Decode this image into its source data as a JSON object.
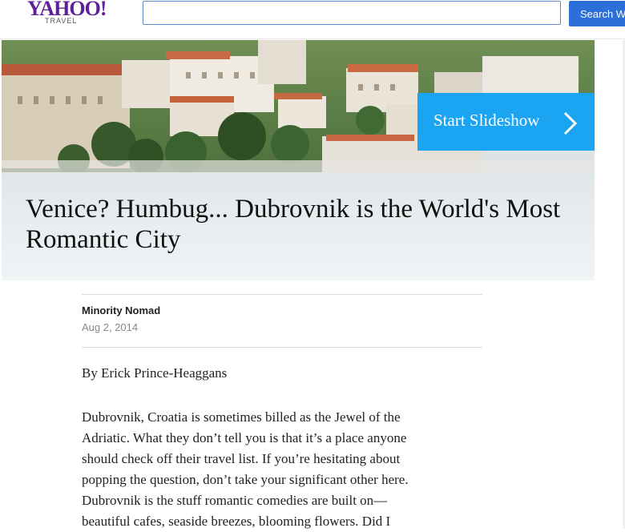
{
  "header": {
    "logo_brand": "YAHOO!",
    "logo_sub": "TRAVEL",
    "search_placeholder": "",
    "search_button_label": "Search Web"
  },
  "hero": {
    "slideshow_label": "Start Slideshow",
    "title": "Venice? Humbug... Dubrovnik is the World's Most Romantic City"
  },
  "article": {
    "author": "Minority Nomad",
    "date": "Aug 2, 2014",
    "byline": "By Erick Prince-Heaggans",
    "body_lines": [
      "Dubrovnik, Croatia is sometimes billed as the Jewel of the",
      "Adriatic. What they don’t tell you is that it’s a place anyone",
      "should check off their travel list. If you’re hesitating about",
      "popping the question, don’t take your significant other here.",
      "Dubrovnik is the stuff romantic comedies are built on—",
      "beautiful cafes, seaside breezes, blooming flowers. Did I"
    ]
  },
  "colors": {
    "brand_purple": "#5f1f9b",
    "search_blue": "#2d6fd8",
    "slideshow_blue": "#1aa4f2"
  },
  "icons": {
    "slideshow_arrow": "chevron-right-icon"
  }
}
